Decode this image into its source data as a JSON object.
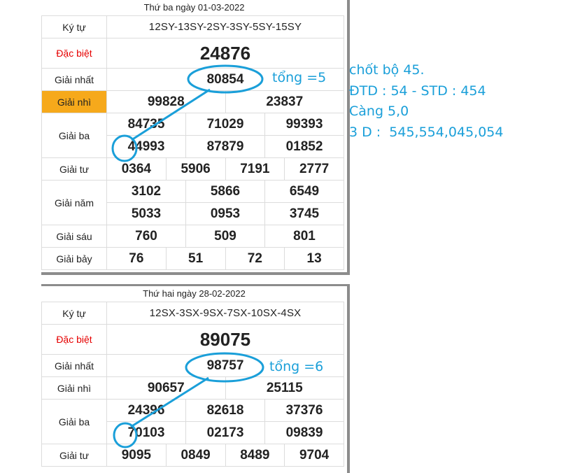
{
  "colors": {
    "accent_blue": "#1a9fd9",
    "special_red": "#e60000",
    "highlight_orange": "#f6a91b"
  },
  "board1": {
    "date_title": "Thứ ba ngày 01-03-2022",
    "labels": {
      "ky_tu": "Ký tự",
      "dac_biet": "Đặc biệt",
      "giai_nhat": "Giải nhất",
      "giai_nhi": "Giải nhì",
      "giai_ba": "Giải ba",
      "giai_tu": "Giải tư",
      "giai_nam": "Giải năm",
      "giai_sau": "Giải sáu",
      "giai_bay": "Giải bảy"
    },
    "ky_tu": "12SY-13SY-2SY-3SY-5SY-15SY",
    "dac_biet": "24876",
    "giai_nhat": "80854",
    "giai_nhi": [
      "99828",
      "23837"
    ],
    "giai_ba": [
      "84735",
      "71029",
      "99393",
      "44993",
      "87879",
      "01852"
    ],
    "giai_tu": [
      "0364",
      "5906",
      "7191",
      "2777"
    ],
    "giai_nam": [
      "3102",
      "5866",
      "6549",
      "5033",
      "0953",
      "3745"
    ],
    "giai_sau": [
      "760",
      "509",
      "801"
    ],
    "giai_bay": [
      "76",
      "51",
      "72",
      "13"
    ],
    "annotation": "tổng =5"
  },
  "board2": {
    "date_title": "Thứ hai ngày 28-02-2022",
    "labels": {
      "ky_tu": "Ký tự",
      "dac_biet": "Đặc biệt",
      "giai_nhat": "Giải nhất",
      "giai_nhi": "Giải nhì",
      "giai_ba": "Giải ba",
      "giai_tu": "Giải tư"
    },
    "ky_tu": "12SX-3SX-9SX-7SX-10SX-4SX",
    "dac_biet": "89075",
    "giai_nhat": "98757",
    "giai_nhi": [
      "90657",
      "25115"
    ],
    "giai_ba": [
      "24396",
      "82618",
      "37376",
      "70103",
      "02173",
      "09839"
    ],
    "giai_tu": [
      "9095",
      "0849",
      "8489",
      "9704"
    ],
    "annotation": "tổng =6"
  },
  "prediction": {
    "line1": "chốt bộ 45.",
    "line2": "ĐTD : 54 - STD : 454",
    "line3": "Càng 5,0",
    "line4": "3 D :  545,554,045,054"
  }
}
